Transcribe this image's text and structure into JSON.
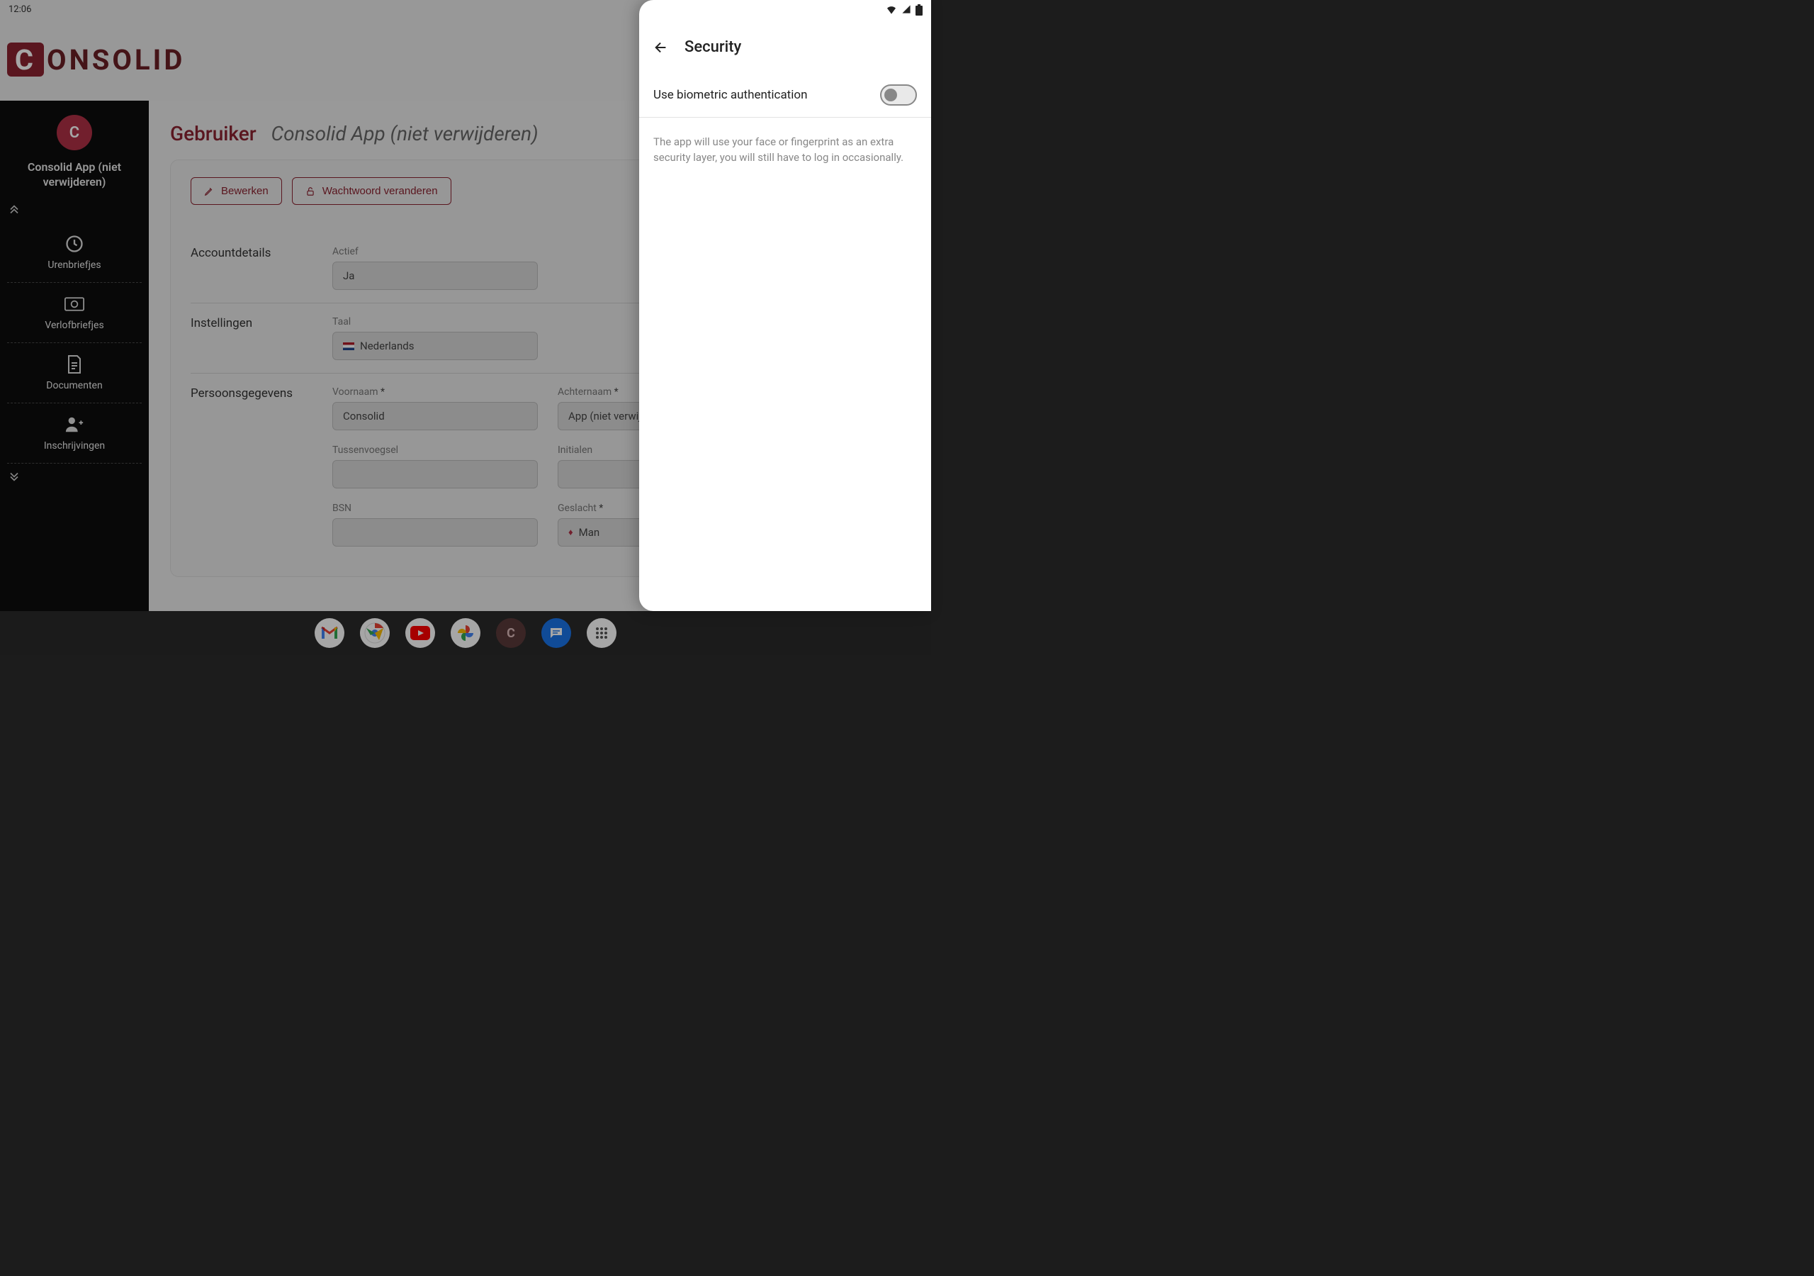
{
  "status": {
    "time": "12:06"
  },
  "logo_text": "ONSOLID",
  "sidebar": {
    "avatar_letter": "C",
    "user": "Consolid App (niet verwijderen)",
    "items": [
      {
        "label": "Urenbriefjes"
      },
      {
        "label": "Verlofbriefjes"
      },
      {
        "label": "Documenten"
      },
      {
        "label": "Inschrijvingen"
      }
    ]
  },
  "main": {
    "title_label": "Gebruiker",
    "title_name": "Consolid App (niet verwijderen)",
    "buttons": {
      "edit": "Bewerken",
      "password": "Wachtwoord veranderen"
    },
    "sections": {
      "account": {
        "heading": "Accountdetails",
        "active_label": "Actief",
        "active_value": "Ja"
      },
      "settings": {
        "heading": "Instellingen",
        "lang_label": "Taal",
        "lang_value": "Nederlands"
      },
      "personal": {
        "heading": "Persoonsgegevens",
        "firstname_label": "Voornaam",
        "firstname_value": "Consolid",
        "lastname_label": "Achternaam",
        "lastname_value": "App (niet verwijderen)",
        "tussen_label": "Tussenvoegsel",
        "tussen_value": "",
        "initials_label": "Initialen",
        "initials_value": "",
        "bsn_label": "BSN",
        "bsn_value": "",
        "gender_label": "Geslacht",
        "gender_value": "Man"
      }
    }
  },
  "sheet": {
    "title": "Security",
    "biometric_label": "Use biometric authentication",
    "biometric_on": false,
    "description": "The app will use your face or fingerprint as an extra security layer, you will still have to log in occasionally."
  }
}
